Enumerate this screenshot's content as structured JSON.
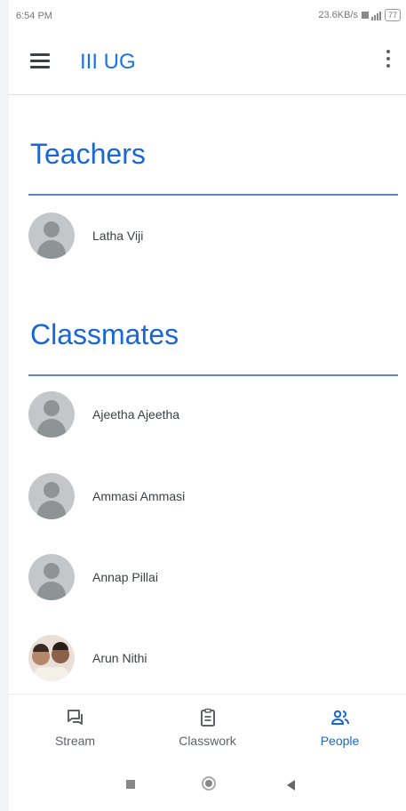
{
  "status_bar": {
    "time": "6:54 PM",
    "network_speed": "23.6KB/s",
    "battery": "77"
  },
  "app_bar": {
    "title": "III UG"
  },
  "teachers": {
    "heading": "Teachers",
    "people": [
      {
        "name": "Latha Viji",
        "avatar": "default"
      }
    ]
  },
  "classmates": {
    "heading": "Classmates",
    "people": [
      {
        "name": "Ajeetha Ajeetha",
        "avatar": "default"
      },
      {
        "name": "Ammasi Ammasi",
        "avatar": "default"
      },
      {
        "name": "Annap Pillai",
        "avatar": "default"
      },
      {
        "name": "Arun Nithi",
        "avatar": "photo"
      }
    ]
  },
  "bottom_nav": {
    "items": [
      {
        "label": "Stream",
        "icon": "stream-icon",
        "active": false
      },
      {
        "label": "Classwork",
        "icon": "classwork-icon",
        "active": false
      },
      {
        "label": "People",
        "icon": "people-icon",
        "active": true
      }
    ]
  },
  "colors": {
    "accent": "#1967d2",
    "icon_gray": "#5f6368"
  }
}
